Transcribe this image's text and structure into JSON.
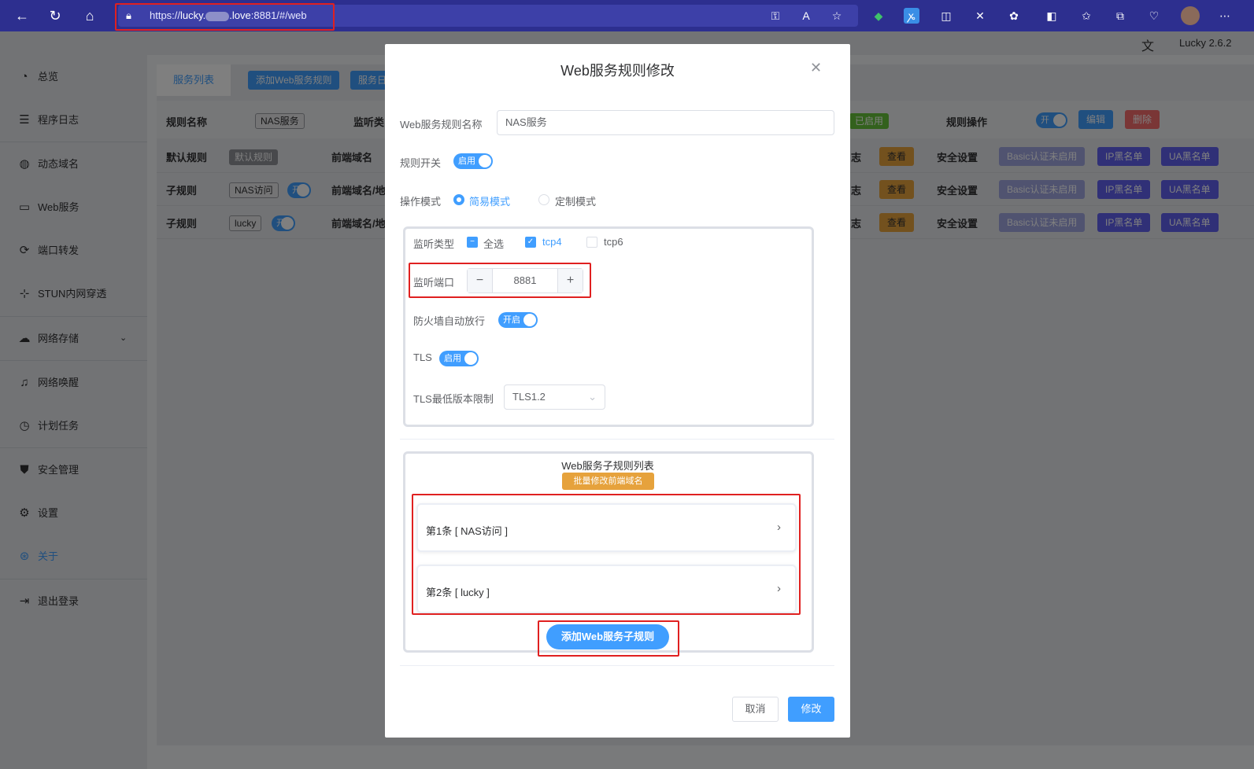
{
  "browser": {
    "url_prefix": "https://",
    "url_host_a": "lucky.",
    "url_host_b": ".love",
    "url_rest": ":8881/#/web",
    "version": "Lucky 2.6.2"
  },
  "sidebar": {
    "items": [
      {
        "label": "总览",
        "icon": "dashboard-icon"
      },
      {
        "label": "程序日志",
        "icon": "log-icon"
      },
      {
        "label": "动态域名",
        "icon": "globe-icon"
      },
      {
        "label": "Web服务",
        "icon": "window-icon"
      },
      {
        "label": "端口转发",
        "icon": "forward-icon"
      },
      {
        "label": "STUN内网穿透",
        "icon": "network-icon"
      },
      {
        "label": "网络存储",
        "icon": "cloud-icon"
      },
      {
        "label": "网络唤醒",
        "icon": "bell-icon"
      },
      {
        "label": "计划任务",
        "icon": "clock-icon"
      },
      {
        "label": "安全管理",
        "icon": "shield-icon"
      },
      {
        "label": "设置",
        "icon": "gear-icon"
      },
      {
        "label": "关于",
        "icon": "about-icon"
      },
      {
        "label": "退出登录",
        "icon": "logout-icon"
      }
    ],
    "active_color": "#409eff"
  },
  "background": {
    "tabs": [
      "服务列表",
      "添加Web服务规则",
      "服务日"
    ],
    "rule_name_label": "规则名称",
    "rule_name_value": "NAS服务",
    "listen_label": "监听类",
    "enabled_tag": "已启用",
    "rule_ops_label": "规则操作",
    "switch_on": "开",
    "edit_btn": "编辑",
    "delete_btn": "删除",
    "rows": [
      {
        "type": "默认规则",
        "tag": "默认规则",
        "frontend": "前端域名",
        "log": "志",
        "view": "查看",
        "security": "安全设置",
        "basic": "Basic认证未启用",
        "ip": "IP黑名单",
        "ua": "UA黑名单"
      },
      {
        "type": "子规则",
        "tag": "NAS访问",
        "switch": "开",
        "frontend": "前端域名/地",
        "log": "志",
        "view": "查看",
        "security": "安全设置",
        "basic": "Basic认证未启用",
        "ip": "IP黑名单",
        "ua": "UA黑名单"
      },
      {
        "type": "子规则",
        "tag": "lucky",
        "switch": "开",
        "frontend": "前端域名/地",
        "log": "志",
        "view": "查看",
        "security": "安全设置",
        "basic": "Basic认证未启用",
        "ip": "IP黑名单",
        "ua": "UA黑名单"
      }
    ]
  },
  "dialog": {
    "title": "Web服务规则修改",
    "name_label": "Web服务规则名称",
    "name_value": "NAS服务",
    "switch_label": "规则开关",
    "switch_value": "启用",
    "mode_label": "操作模式",
    "mode_simple": "简易模式",
    "mode_custom": "定制模式",
    "listen_type_label": "监听类型",
    "select_all": "全选",
    "tcp4": "tcp4",
    "tcp6": "tcp6",
    "port_label": "监听端口",
    "port_value": "8881",
    "firewall_label": "防火墙自动放行",
    "firewall_value": "开启",
    "tls_label": "TLS",
    "tls_value": "启用",
    "tls_min_label": "TLS最低版本限制",
    "tls_min_value": "TLS1.2",
    "sub_list_title": "Web服务子规则列表",
    "batch_btn": "批量修改前端域名",
    "sub_rules": [
      "第1条 [ NAS访问 ]",
      "第2条 [ lucky ]"
    ],
    "add_sub_btn": "添加Web服务子规则",
    "cancel_btn": "取消",
    "confirm_btn": "修改"
  }
}
